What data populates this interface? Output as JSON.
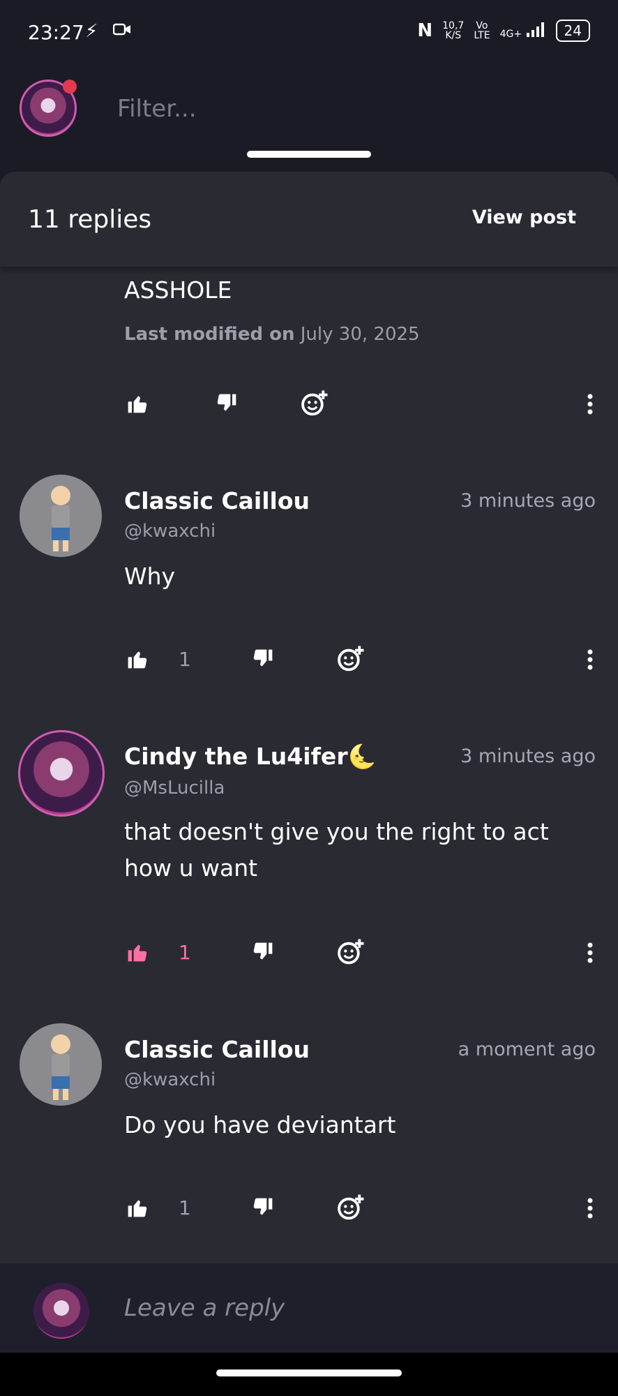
{
  "status_bar": {
    "time": "23:27",
    "speed": "10,7",
    "speed_unit": "K/S",
    "network": "4G+",
    "battery": "24"
  },
  "top_bar": {
    "filter_placeholder": "Filter..."
  },
  "sheet": {
    "replies_label": "11 replies",
    "view_post_label": "View post"
  },
  "partial_comment": {
    "text": "ASSHOLE",
    "modified_label": "Last modified on",
    "modified_date": "July 30, 2025"
  },
  "comments": [
    {
      "name": "Classic Caillou",
      "handle": "@kwaxchi",
      "time": "3 minutes ago",
      "text": "Why",
      "likes": "1",
      "liked": false
    },
    {
      "name": "Cindy the Lu4ifer🌜",
      "handle": "@MsLucilla",
      "time": "3 minutes ago",
      "text": "that doesn't give you the right to act how u want",
      "likes": "1",
      "liked": true
    },
    {
      "name": "Classic Caillou",
      "handle": "@kwaxchi",
      "time": "a moment ago",
      "text": "Do you have deviantart",
      "likes": "1",
      "liked": false
    }
  ],
  "reply_bar": {
    "placeholder": "Leave a reply"
  },
  "icons": [
    "thumbs-up-icon",
    "thumbs-down-icon",
    "add-reaction-icon",
    "more-vertical-icon",
    "flash-icon",
    "video-icon",
    "nfc-icon",
    "signal-icon",
    "battery-icon"
  ],
  "colors": {
    "background": "#1b1b26",
    "sheet": "#2a2a33",
    "accent_pink": "#ff6fa3",
    "muted": "#9e9ea8"
  }
}
